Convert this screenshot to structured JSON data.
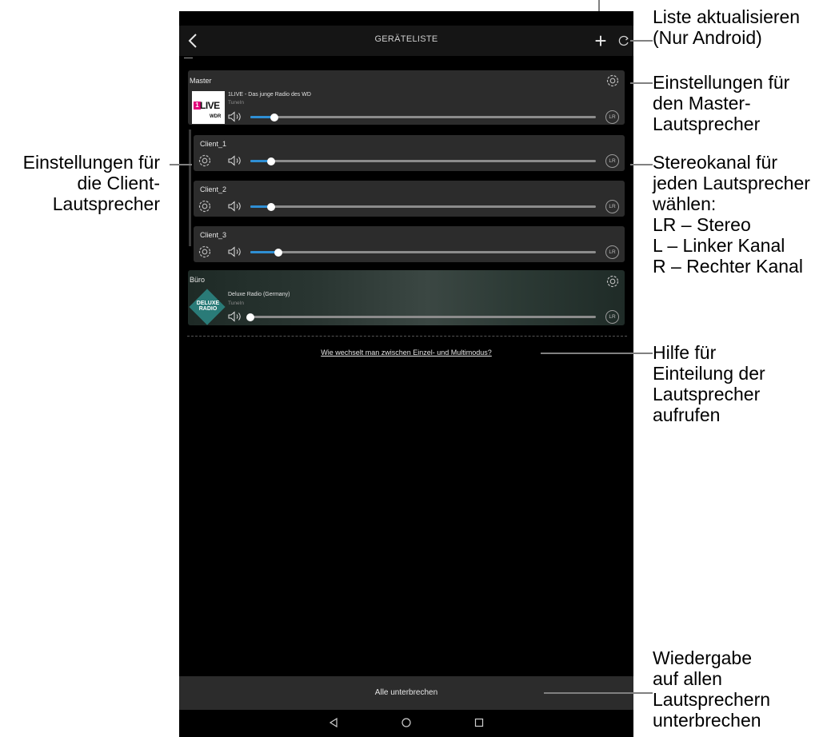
{
  "app": {
    "title": "GERÄTELISTE",
    "actions": {
      "back_icon": "chevron-left-icon",
      "add_icon": "plus-icon",
      "add_label": "+",
      "refresh_icon": "refresh-icon"
    }
  },
  "devices": {
    "master": {
      "name": "Master",
      "station": "1LIVE - Das junge Radio des WD",
      "source": "TuneIn",
      "volume_fraction": 0.07,
      "channel": "LR",
      "logo": {
        "one": "1",
        "live": "LIVE",
        "wdr": "WDR"
      }
    },
    "clients": [
      {
        "name": "Client_1",
        "volume_fraction": 0.06,
        "channel": "LR"
      },
      {
        "name": "Client_2",
        "volume_fraction": 0.06,
        "channel": "LR"
      },
      {
        "name": "Client_3",
        "volume_fraction": 0.08,
        "channel": "LR"
      }
    ],
    "buero": {
      "name": "Büro",
      "station": "Deluxe Radio (Germany)",
      "source": "TuneIn",
      "volume_fraction": 0.0,
      "channel": "LR",
      "logo_line1": "DELUXE",
      "logo_line2": "RADIO"
    }
  },
  "help_link": "Wie wechselt man zwischen Einzel- und Multimodus?",
  "stop_all_button": "Alle unterbrechen",
  "navigation": [
    "back-triangle-icon",
    "home-circle-icon",
    "recents-square-icon"
  ],
  "annotations": {
    "add_speaker_line1": "Liste aktualisieren",
    "add_speaker_line2": "(Nur Android)",
    "master_settings": [
      "Einstellungen für",
      "den Master-",
      "Lautsprecher"
    ],
    "client_settings": [
      "Einstellungen für",
      "die Client-",
      "Lautsprecher"
    ],
    "stereo_channel": [
      "Stereokanal für",
      "jeden Lautsprecher",
      "wählen:",
      "LR – Stereo",
      "L – Linker Kanal",
      "R – Rechter Kanal"
    ],
    "help": [
      "Hilfe für",
      "Einteilung der",
      "Lautsprecher",
      "aufrufen"
    ],
    "stop_all": [
      "Wiedergabe",
      "auf allen",
      "Lautsprechern",
      "unterbrechen"
    ]
  },
  "colors": {
    "accent": "#2f8fd4",
    "card": "#2c2c2c",
    "background": "#000000",
    "annotation_line": "#808080"
  }
}
